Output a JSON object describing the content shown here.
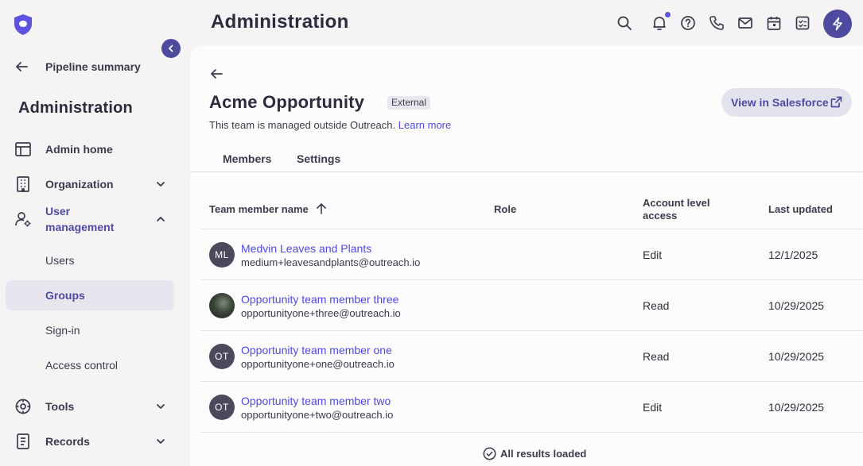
{
  "header": {
    "title": "Administration"
  },
  "sidebar": {
    "back_label": "Pipeline summary",
    "title": "Administration",
    "items": [
      {
        "label": "Admin home",
        "icon": "layout-icon"
      },
      {
        "label": "Organization",
        "icon": "building-icon"
      },
      {
        "label": "User management",
        "icon": "user-gear-icon"
      },
      {
        "label": "Tools",
        "icon": "tools-icon"
      },
      {
        "label": "Records",
        "icon": "records-icon"
      }
    ],
    "sub_items": [
      {
        "label": "Users"
      },
      {
        "label": "Groups"
      },
      {
        "label": "Sign-in"
      },
      {
        "label": "Access control"
      }
    ]
  },
  "team": {
    "name": "Acme Opportunity",
    "badge": "External",
    "managed_text": "This team is managed outside Outreach.",
    "learn_more": "Learn more",
    "salesforce_button": "View in Salesforce"
  },
  "tabs": [
    {
      "label": "Members"
    },
    {
      "label": "Settings"
    }
  ],
  "table": {
    "headers": {
      "name": "Team member name",
      "role": "Role",
      "access": "Account level access",
      "updated": "Last updated"
    },
    "rows": [
      {
        "initials": "ML",
        "name": "Medvin Leaves and Plants",
        "email": "medium+leavesandplants@outreach.io",
        "role": "",
        "access": "Edit",
        "updated": "12/1/2025"
      },
      {
        "initials": "",
        "name": "Opportunity team member three",
        "email": "opportunityone+three@outreach.io",
        "role": "",
        "access": "Read",
        "updated": "10/29/2025"
      },
      {
        "initials": "OT",
        "name": "Opportunity team member one",
        "email": "opportunityone+one@outreach.io",
        "role": "",
        "access": "Read",
        "updated": "10/29/2025"
      },
      {
        "initials": "OT",
        "name": "Opportunity team member two",
        "email": "opportunityone+two@outreach.io",
        "role": "",
        "access": "Edit",
        "updated": "10/29/2025"
      }
    ],
    "footer": "All results loaded"
  },
  "colors": {
    "accent": "#4e4a9f",
    "link": "#4e4adf",
    "selected_bg": "#e8e5ef"
  }
}
